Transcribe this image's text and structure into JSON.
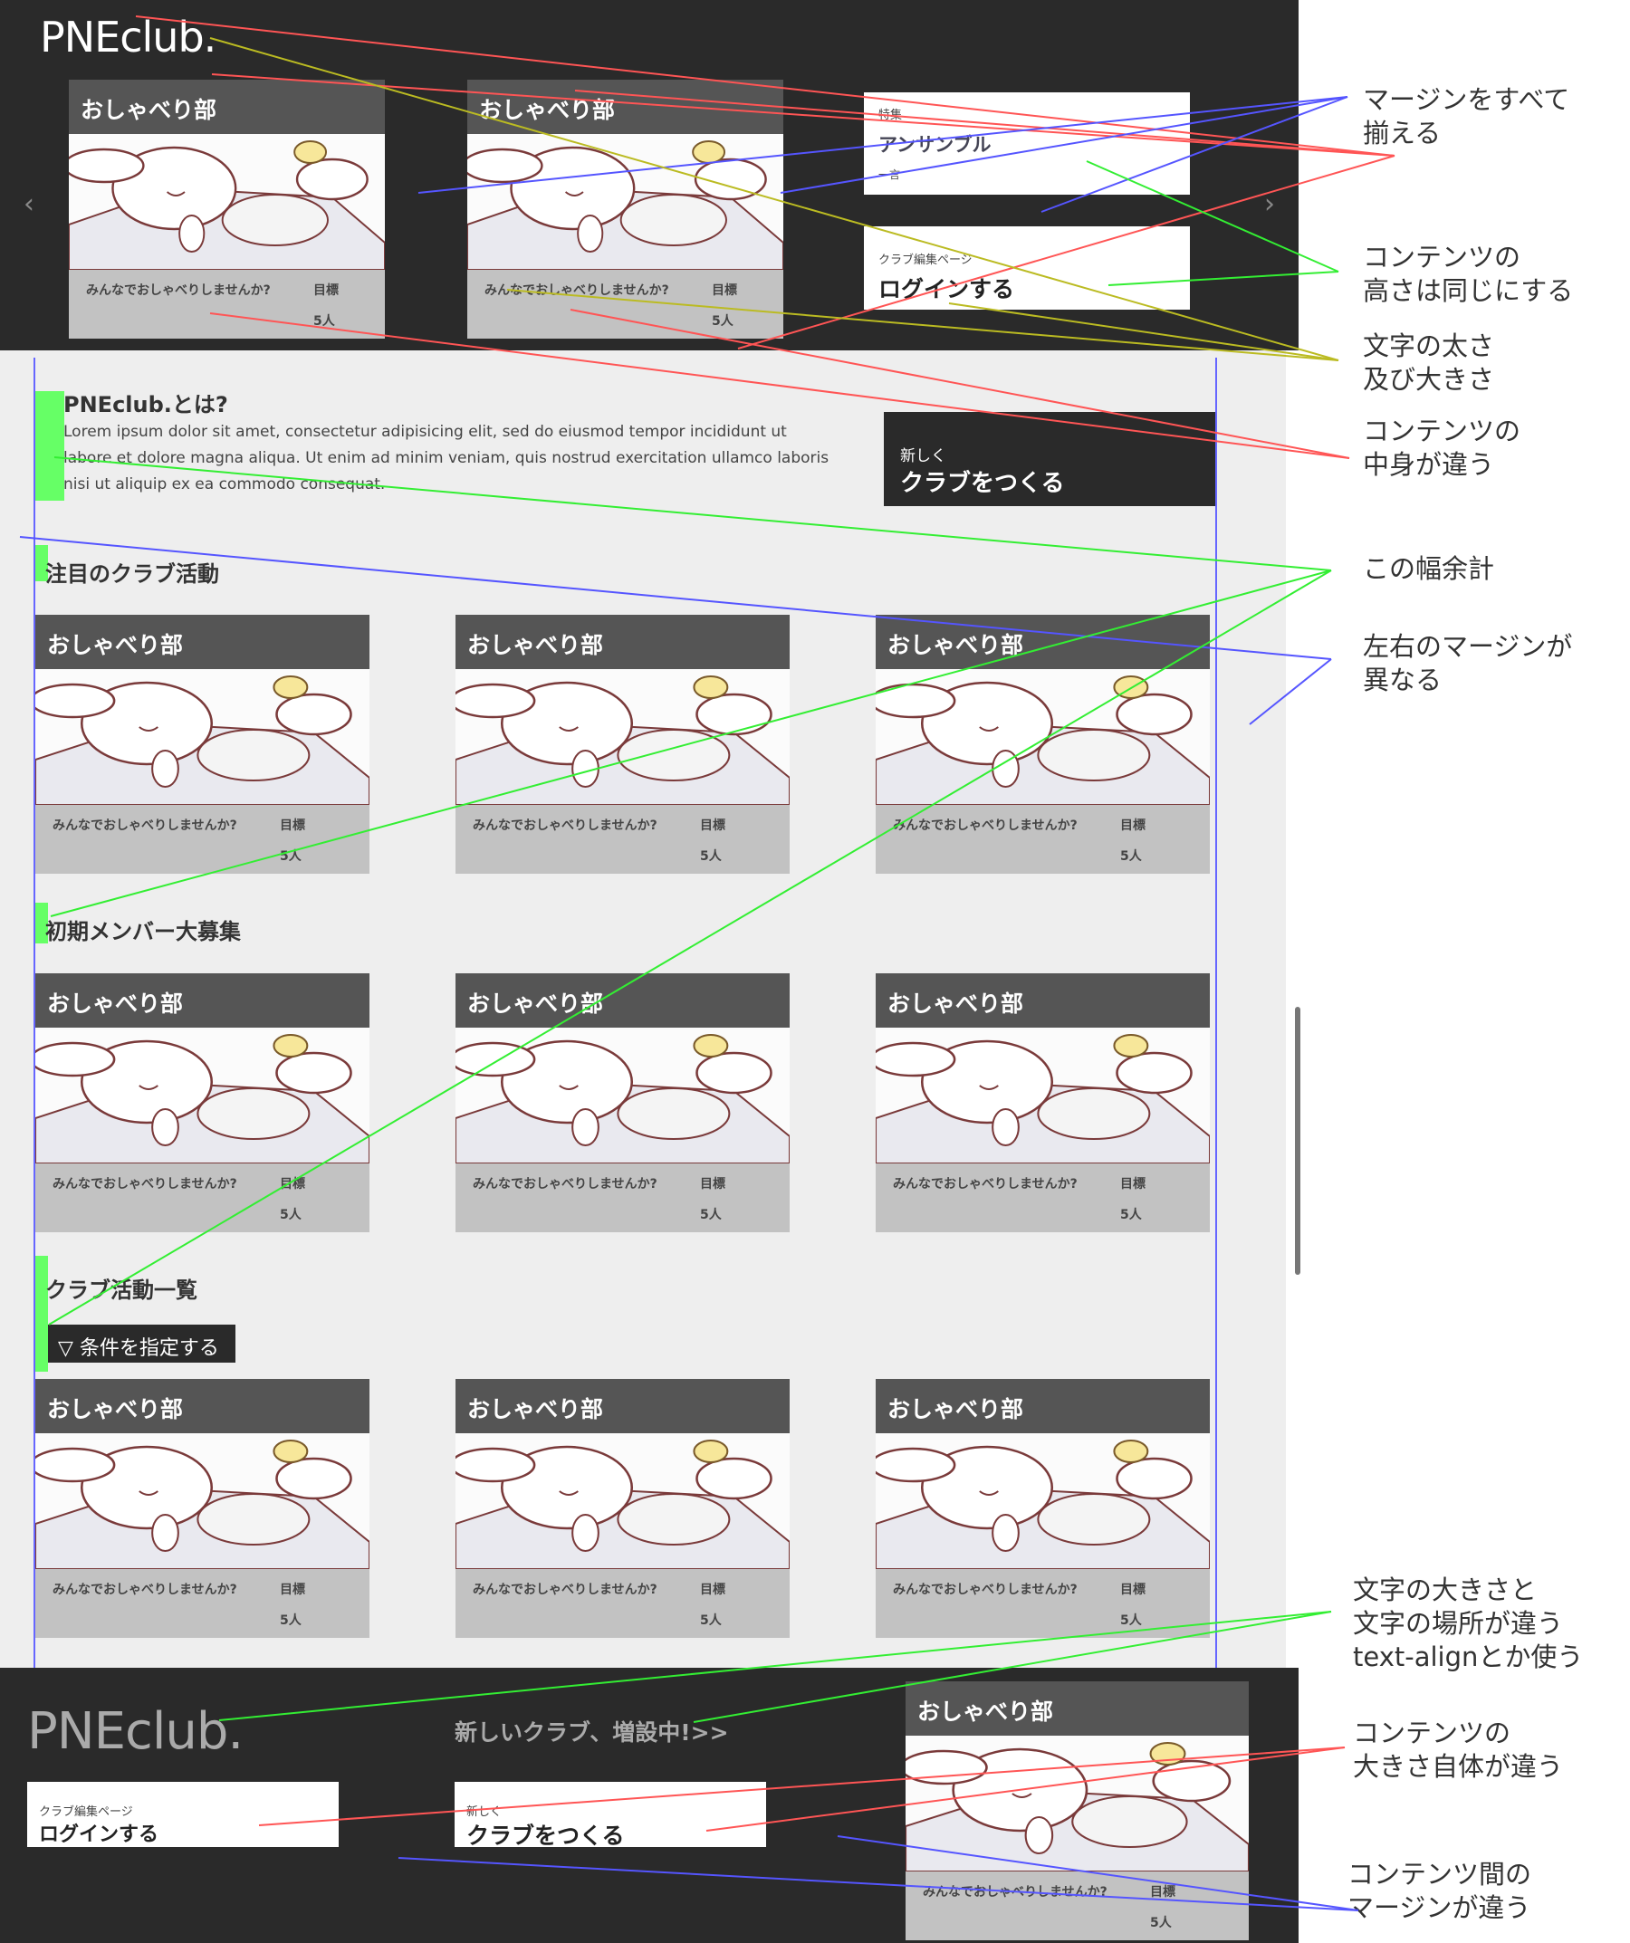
{
  "brand": {
    "logo": "PNEclub."
  },
  "card": {
    "title": "おしゃべり部",
    "description": "みんなでおしゃべりしませんか?",
    "goal_label": "目標",
    "members": "5人"
  },
  "header": {
    "prev_arrow": "‹",
    "next_arrow": "›",
    "feature_panel": {
      "label": "特集",
      "title": "アンサンブル",
      "note": "一言"
    },
    "login_panel": {
      "label": "クラブ編集ページ",
      "title": "ログインする"
    }
  },
  "about": {
    "title": "PNEclub.とは?",
    "body": "Lorem ipsum dolor sit amet, consectetur adipisicing elit, sed do eiusmod tempor incididunt ut labore et dolore magna aliqua. Ut enim ad minim veniam, quis nostrud exercitation ullamco laboris nisi ut aliquip ex ea commodo consequat.",
    "create_button": {
      "small": "新しく",
      "big": "クラブをつくる"
    }
  },
  "sections": {
    "featured": "注目のクラブ活動",
    "recruiting": "初期メンバー大募集",
    "all_clubs": "クラブ活動一覧",
    "filter_button": "▽ 条件を指定する"
  },
  "footer": {
    "logo": "PNEclub.",
    "promo": "新しいクラブ、増設中!>>",
    "login": {
      "label": "クラブ編集ページ",
      "title": "ログインする"
    },
    "create": {
      "label": "新しく",
      "title": "クラブをつくる"
    }
  },
  "annotations": [
    "マージンをすべて\n揃える",
    "コンテンツの\n高さは同じにする",
    "文字の太さ\n及び大きさ",
    "コンテンツの\n中身が違う",
    "この幅余計",
    "左右のマージンが\n異なる",
    "文字の大きさと\n文字の場所が違う\ntext-alignとか使う",
    "コンテンツの\n大きさ自体が違う",
    "コンテンツ間の\nマージンが違う"
  ],
  "colors": {
    "header_bg": "#2a2a2a",
    "main_bg": "#eeeeee",
    "card_title_bg": "#555555",
    "card_footer_bg": "#c2c2c2",
    "annotation_red": "#ff5555",
    "annotation_blue": "#5555ff",
    "annotation_green": "#33ee33",
    "annotation_olive": "#bbbb22"
  }
}
